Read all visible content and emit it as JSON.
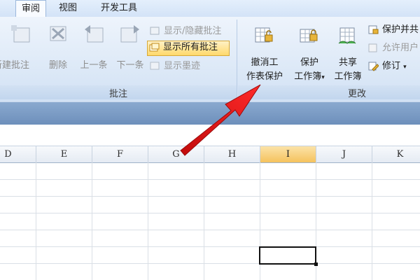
{
  "tabs": [
    {
      "label": "审阅",
      "active": true
    },
    {
      "label": "视图",
      "active": false
    },
    {
      "label": "开发工具",
      "active": false
    }
  ],
  "comments_group": {
    "label": "批注",
    "new_comment": "新建批注",
    "delete": "删除",
    "previous": "上一条",
    "next": "下一条",
    "show_hide_comment": "显示/隐藏批注",
    "show_all_comments": "显示所有批注",
    "show_ink": "显示墨迹"
  },
  "changes_group": {
    "label": "更改",
    "unprotect_sheet_line1": "撤消工",
    "unprotect_sheet_line2": "作表保护",
    "protect_workbook_line1": "保护",
    "protect_workbook_line2": "工作簿",
    "share_workbook_line1": "共享",
    "share_workbook_line2": "工作簿",
    "protect_and_share": "保护并共",
    "allow_users": "允许用户",
    "track_changes": "修订"
  },
  "columns": [
    "D",
    "E",
    "F",
    "G",
    "H",
    "I",
    "J",
    "K"
  ],
  "selected_column": "I",
  "colors": {
    "accent_highlight": "#ffd96b",
    "selected_header": "#f5c25d",
    "arrow": "#e01414"
  }
}
